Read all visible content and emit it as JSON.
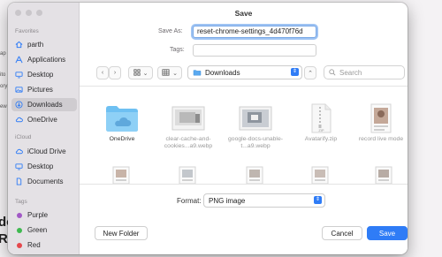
{
  "background_app": {
    "texts": [
      "ap",
      "ito",
      "ory",
      "ew"
    ],
    "big_texts": [
      "do",
      "Re"
    ]
  },
  "dialog": {
    "title": "Save",
    "save_as_label": "Save As:",
    "save_as_value": "reset-chrome-settings_4d470f76d",
    "tags_label": "Tags:",
    "tags_value": ""
  },
  "sidebar": {
    "favorites_header": "Favorites",
    "favorites": [
      {
        "label": "parth",
        "icon": "home-icon"
      },
      {
        "label": "Applications",
        "icon": "applications-icon"
      },
      {
        "label": "Desktop",
        "icon": "desktop-icon"
      },
      {
        "label": "Pictures",
        "icon": "pictures-icon"
      },
      {
        "label": "Downloads",
        "icon": "downloads-icon",
        "selected": true
      },
      {
        "label": "OneDrive",
        "icon": "cloud-icon"
      }
    ],
    "icloud_header": "iCloud",
    "icloud": [
      {
        "label": "iCloud Drive",
        "icon": "icloud-icon"
      },
      {
        "label": "Desktop",
        "icon": "desktop-icon"
      },
      {
        "label": "Documents",
        "icon": "documents-icon"
      }
    ],
    "tags_header": "Tags",
    "tags": [
      {
        "label": "Purple",
        "color": "#a259c6"
      },
      {
        "label": "Green",
        "color": "#3fb950"
      },
      {
        "label": "Red",
        "color": "#e5484d"
      }
    ]
  },
  "toolbar": {
    "back": "‹",
    "forward": "›",
    "view_grid_chevron": "⌄",
    "view_group_chevron": "⌄",
    "location": "Downloads",
    "expand": "⌃",
    "search_placeholder": "Search"
  },
  "files_row1": [
    {
      "name": "OneDrive",
      "kind": "folder"
    },
    {
      "name": "clear-cache-and-cookies...a9.webp",
      "kind": "image"
    },
    {
      "name": "google-docs-unable-t...a9.webp",
      "kind": "image"
    },
    {
      "name": "Avatarify.zip",
      "kind": "zip"
    },
    {
      "name": "record live mode",
      "kind": "doc"
    }
  ],
  "format": {
    "label": "Format:",
    "value": "PNG image"
  },
  "buttons": {
    "new_folder": "New Folder",
    "cancel": "Cancel",
    "save": "Save"
  },
  "colors": {
    "accent": "#2f7cf6",
    "sidebar_bg": "#e4e1e5"
  }
}
